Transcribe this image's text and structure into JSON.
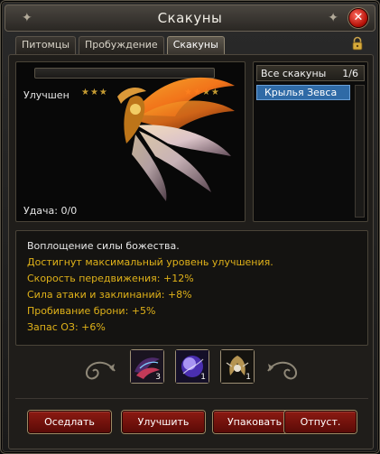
{
  "window": {
    "title": "Скакуны",
    "close_glyph": "✕"
  },
  "tabs": [
    {
      "label": "Питомцы",
      "active": false
    },
    {
      "label": "Пробуждение",
      "active": false
    },
    {
      "label": "Скакуны",
      "active": true
    }
  ],
  "preview": {
    "enhanced_label": "Улучшен",
    "stars_left": "★★★",
    "stars_right": "★★★★",
    "luck_text": "Удача: 0/0"
  },
  "mount_list": {
    "header_label": "Все скакуны",
    "count": "1/6",
    "items": [
      {
        "name": "Крылья Зевса",
        "selected": true
      }
    ]
  },
  "description": {
    "lines": [
      {
        "text": "Воплощение силы божества.",
        "color": "white"
      },
      {
        "text": "Достигнут максимальный уровень улучшения.",
        "color": "gold"
      },
      {
        "text": "Скорость передвижения: +12%",
        "color": "gold"
      },
      {
        "text": "Сила атаки и заклинаний: +8%",
        "color": "gold"
      },
      {
        "text": "Пробивание брони: +5%",
        "color": "gold"
      },
      {
        "text": "Запас ОЗ: +6%",
        "color": "gold"
      }
    ]
  },
  "items": [
    {
      "icon": "dark-wings-icon",
      "count": "3"
    },
    {
      "icon": "purple-orb-icon",
      "count": "1"
    },
    {
      "icon": "winged-emblem-icon",
      "count": "1"
    }
  ],
  "buttons": {
    "saddle": "Оседлать",
    "enhance": "Улучшить",
    "pack": "Упаковать",
    "release": "Отпуст."
  },
  "colors": {
    "gold_text": "#e0b219",
    "selection_blue": "#2f6aa6",
    "button_red": "#8c1a12"
  }
}
